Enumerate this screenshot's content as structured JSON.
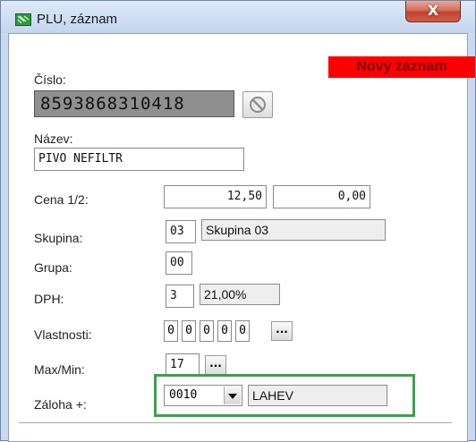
{
  "window": {
    "title": "PLU, záznam",
    "close_label": "X"
  },
  "badge": {
    "text": "Nový záznam"
  },
  "cislo": {
    "label": "Číslo:",
    "value": "8593868310418"
  },
  "nazev": {
    "label": "Název:",
    "value": "PIVO NEFILTR"
  },
  "cena": {
    "label": "Cena 1/2:",
    "value1": "12,50",
    "value2": "0,00"
  },
  "skupina": {
    "label": "Skupina:",
    "code": "03",
    "name": "Skupina 03"
  },
  "grupa": {
    "label": "Grupa:",
    "code": "00"
  },
  "dph": {
    "label": "DPH:",
    "code": "3",
    "rate": "21,00%"
  },
  "vlastnosti": {
    "label": "Vlastnosti:",
    "digits": [
      "0",
      "0",
      "0",
      "0",
      "0"
    ],
    "button": "..."
  },
  "maxmin": {
    "label": "Max/Min:",
    "value": "17",
    "button": "..."
  },
  "zaloha": {
    "label": "Záloha +:",
    "code": "0010",
    "name": "LAHEV"
  }
}
